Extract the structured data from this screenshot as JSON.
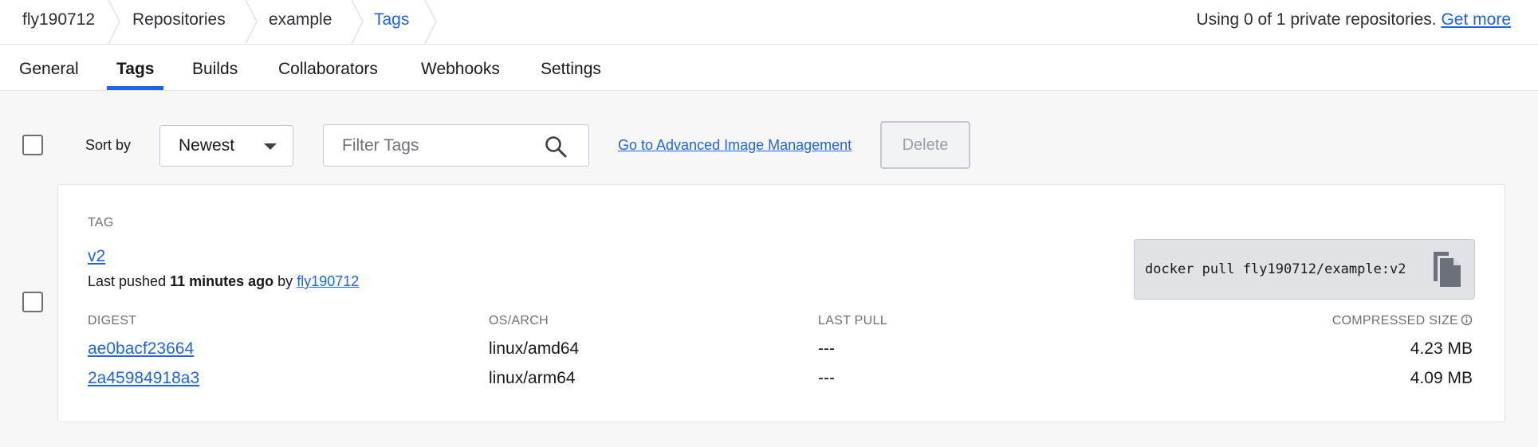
{
  "breadcrumb": {
    "items": [
      {
        "label": "fly190712"
      },
      {
        "label": "Repositories"
      },
      {
        "label": "example"
      },
      {
        "label": "Tags"
      }
    ]
  },
  "usage": {
    "text": "Using 0 of 1 private repositories.",
    "link": "Get more"
  },
  "tabs": [
    {
      "label": "General"
    },
    {
      "label": "Tags",
      "active": true
    },
    {
      "label": "Builds"
    },
    {
      "label": "Collaborators"
    },
    {
      "label": "Webhooks"
    },
    {
      "label": "Settings"
    }
  ],
  "toolbar": {
    "sort_label": "Sort by",
    "sort_value": "Newest",
    "filter_placeholder": "Filter Tags",
    "advanced_link": "Go to Advanced Image Management",
    "delete_label": "Delete"
  },
  "tag_card": {
    "tag_header": "TAG",
    "tag_name": "v2",
    "pushed_prefix": "Last pushed",
    "pushed_time": "11 minutes ago",
    "pushed_by_word": "by",
    "pushed_by_user": "fly190712",
    "pull_command": "docker pull fly190712/example:v2",
    "columns": {
      "digest": "DIGEST",
      "os_arch": "OS/ARCH",
      "last_pull": "LAST PULL",
      "compressed_size": "COMPRESSED SIZE"
    },
    "rows": [
      {
        "digest": "ae0bacf23664",
        "os_arch": "linux/amd64",
        "last_pull": "---",
        "size": "4.23 MB"
      },
      {
        "digest": "2a45984918a3",
        "os_arch": "linux/arm64",
        "last_pull": "---",
        "size": "4.09 MB"
      }
    ]
  },
  "colors": {
    "accent": "#1d63ed",
    "text": "#17191e",
    "muted": "#6c707a",
    "background": "#f7f7f8"
  },
  "icons": [
    "chevron-separator-icon",
    "chevron-down-icon",
    "search-icon",
    "copy-icon",
    "info-icon"
  ]
}
